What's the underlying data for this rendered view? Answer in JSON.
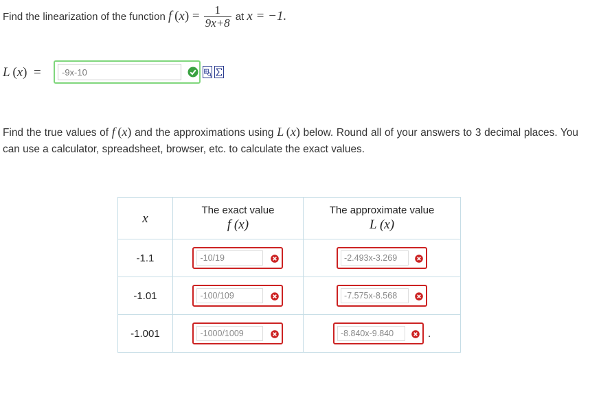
{
  "problem1": {
    "text_before": "Find the linearization of the function",
    "function_name": "f",
    "variable": "x",
    "fraction_numerator": "1",
    "fraction_denominator": "9x+8",
    "text_at": "at",
    "point": "x = −1."
  },
  "linearization": {
    "label_func": "L",
    "label_var": "x",
    "input_value": "-9x-10",
    "status": "correct",
    "colors": {
      "correct_border": "#7fd67c",
      "incorrect_border": "#cc2222",
      "check_fill": "#3aa241",
      "x_fill": "#cc2222"
    },
    "icons": [
      "check-icon",
      "preview-icon",
      "equation-editor-icon"
    ]
  },
  "problem2": {
    "text_1": "Find the true values of",
    "f_name": "f",
    "text_2": "and the approximations using",
    "l_name": "L",
    "text_3": "below. Round all of your answers to 3 decimal places. You can use a calculator, spreadsheet, browser, etc. to calculate the exact values."
  },
  "table": {
    "headers": {
      "x": "x",
      "exact_line1": "The exact value",
      "exact_math": "f (x)",
      "approx_line1": "The approximate value",
      "approx_math": "L (x)"
    },
    "rows": [
      {
        "x": "-1.1",
        "exact": "-10/19",
        "approx": "-2.493x-3.269",
        "exact_status": "incorrect",
        "approx_status": "incorrect"
      },
      {
        "x": "-1.01",
        "exact": "-100/109",
        "approx": "-7.575x-8.568",
        "exact_status": "incorrect",
        "approx_status": "incorrect"
      },
      {
        "x": "-1.001",
        "exact": "-1000/1009",
        "approx": "-8.840x-9.840",
        "exact_status": "incorrect",
        "approx_status": "incorrect"
      }
    ],
    "trailing_period": "."
  }
}
